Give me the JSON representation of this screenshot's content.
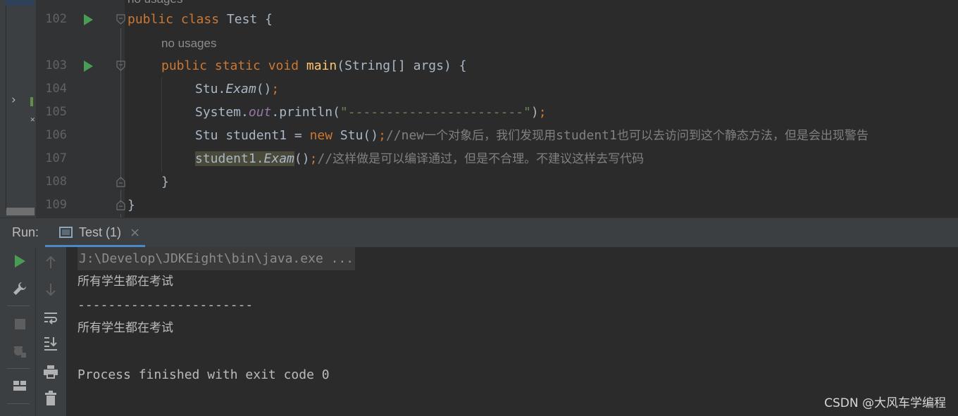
{
  "editor": {
    "top_hint": "no usages",
    "lines": [
      {
        "num": "102",
        "tokens": [
          [
            "kw",
            "public class "
          ],
          [
            "plain",
            "Test {"
          ]
        ]
      },
      {
        "hint": "no usages"
      },
      {
        "num": "103",
        "tokens": [
          [
            "kw",
            "public static void "
          ],
          [
            "fn",
            "main"
          ],
          [
            "plain",
            "(String[] args) {"
          ]
        ]
      },
      {
        "num": "104",
        "tokens": [
          [
            "plain",
            "Stu."
          ],
          [
            "it",
            "Exam"
          ],
          [
            "plain",
            "()"
          ],
          [
            "kw",
            ";"
          ]
        ]
      },
      {
        "num": "105",
        "tokens": [
          [
            "plain",
            "System."
          ],
          [
            "fld",
            "out"
          ],
          [
            "plain",
            ".println("
          ],
          [
            "str",
            "\"-----------------------\""
          ],
          [
            "plain",
            ")"
          ],
          [
            "kw",
            ";"
          ]
        ]
      },
      {
        "num": "106",
        "tokens": [
          [
            "plain",
            "Stu student1 = "
          ],
          [
            "kw",
            "new "
          ],
          [
            "plain",
            "Stu()"
          ],
          [
            "kw",
            ";"
          ],
          [
            "cmt-mono",
            "//new"
          ],
          [
            "cmt",
            "一个对象后，我们发现用"
          ],
          [
            "cmt-mono",
            "student1"
          ],
          [
            "cmt",
            "也可以去访问到这个静态方法，但是会出现警告"
          ]
        ]
      },
      {
        "num": "107",
        "tokens": [
          [
            "hl",
            "student1."
          ],
          [
            "hl-it",
            "Exam"
          ],
          [
            "plain",
            "()"
          ],
          [
            "kw",
            ";"
          ],
          [
            "cmt-mono",
            "//"
          ],
          [
            "cmt",
            "这样做是可以编译通过，但是不合理。不建议这样去写代码"
          ]
        ]
      },
      {
        "num": "108",
        "tokens": [
          [
            "plain",
            "}"
          ]
        ]
      },
      {
        "num": "109",
        "tokens": [
          [
            "plain",
            "}"
          ]
        ]
      }
    ]
  },
  "run": {
    "label": "Run:",
    "tab_title": "Test (1)",
    "tab_close": "×",
    "console": [
      "J:\\Develop\\JDKEight\\bin\\java.exe ...",
      "所有学生都在考试",
      "-----------------------",
      "所有学生都在考试",
      "",
      "Process finished with exit code 0"
    ]
  },
  "watermark": "CSDN @大风车学编程",
  "icons": {
    "run": "run-icon",
    "fold": "fold-icon",
    "rerun": "play-icon",
    "settings": "wrench-icon",
    "stop": "stop-icon",
    "up": "arrow-up-icon",
    "down": "arrow-down-icon",
    "wrap": "soft-wrap-icon",
    "scroll_end": "scroll-to-end-icon",
    "print": "print-icon",
    "trash": "trash-icon"
  },
  "colors": {
    "keyword": "#cc7832",
    "function": "#ffc66d",
    "string": "#6a8759",
    "field": "#9876aa",
    "comment": "#808080",
    "run_green": "#499c54",
    "tab_accent": "#4a88c7"
  }
}
